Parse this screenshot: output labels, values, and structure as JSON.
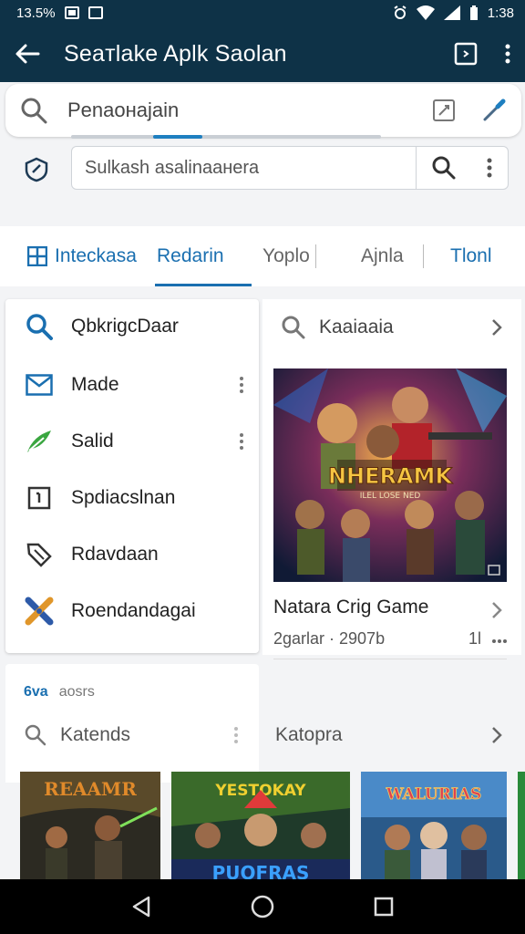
{
  "status_bar": {
    "left_text": "13.5%",
    "time": "1:38"
  },
  "app_bar": {
    "title": "Seaтlake Aplk Saolan"
  },
  "search": {
    "placeholder": "Penaoнajain"
  },
  "secondary_search": {
    "value": "Sulkash asalinaaнera"
  },
  "tabs": [
    {
      "label": "Inteckasa"
    },
    {
      "label": "Redarin"
    },
    {
      "label": "Yoplo"
    },
    {
      "label": "Ajnla"
    },
    {
      "label": "Tlonl"
    }
  ],
  "menu": {
    "items": [
      {
        "label": "QbkrigcDaar",
        "icon": "search-icon"
      },
      {
        "label": "Made",
        "icon": "mail-icon"
      },
      {
        "label": "Salid",
        "icon": "send-icon"
      },
      {
        "label": "Spdiacslnan",
        "icon": "square-icon"
      },
      {
        "label": "Rdavdaan",
        "icon": "tag-icon"
      },
      {
        "label": "Roendandagai",
        "icon": "tools-icon"
      }
    ]
  },
  "right_card": {
    "header": "Kaaiaaia",
    "game_title": "Natara Crig Game",
    "game_meta": "2garlar · 2907b",
    "game_meta_right": "1l",
    "poster_text": "NHERAMK",
    "poster_sub": "ILEL LOSE NED"
  },
  "bottom_left": {
    "small_a": "6va",
    "small_b": "aosrs",
    "row_label": "Katends"
  },
  "bottom_right": {
    "row_label": "Katopra"
  },
  "thumbnails": [
    {
      "text": "REAAMR"
    },
    {
      "text": "YESTOKAY"
    },
    {
      "text": "WALURIAS"
    }
  ],
  "thumbnail_sub": "PUOFRAS",
  "colors": {
    "appbar": "#0e3247",
    "accent": "#1a6fb0",
    "background": "#f3f4f6"
  }
}
